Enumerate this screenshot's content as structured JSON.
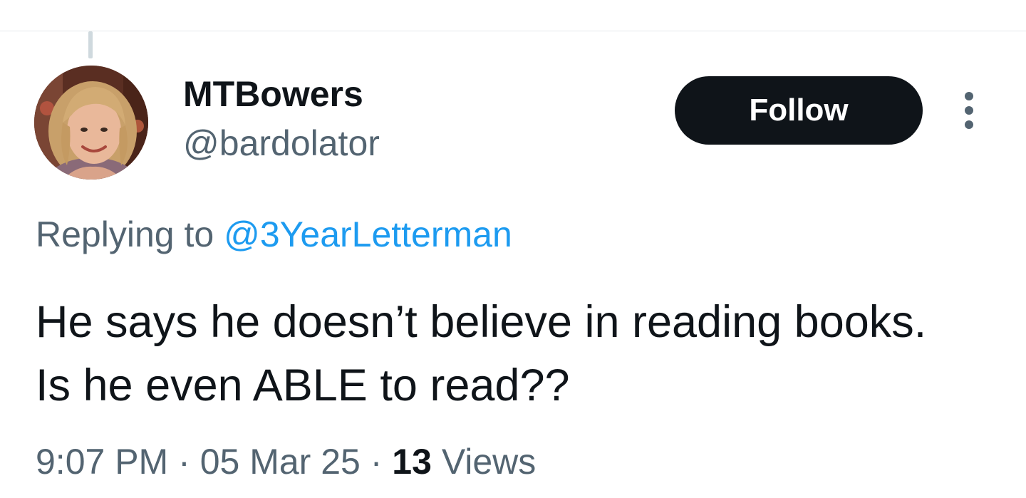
{
  "tweet": {
    "author": {
      "display_name": "MTBowers",
      "handle": "@bardolator",
      "avatar_icon": "profile-photo"
    },
    "follow_label": "Follow",
    "more_icon": "more-vertical-icon",
    "replying_to_prefix": "Replying to",
    "replying_to_handle": "@3YearLetterman",
    "text": "He says he doesn’t believe in reading books. Is he even ABLE to read??",
    "time": "9:07 PM",
    "separator": "·",
    "date": "05 Mar 25",
    "views_count": "13",
    "views_label": "Views"
  },
  "colors": {
    "primary_text": "#0f1419",
    "secondary_text": "#536471",
    "link": "#1d9bf0",
    "follow_button_bg": "#0f1419",
    "follow_button_text": "#ffffff",
    "thread_line": "#cfd9de"
  }
}
